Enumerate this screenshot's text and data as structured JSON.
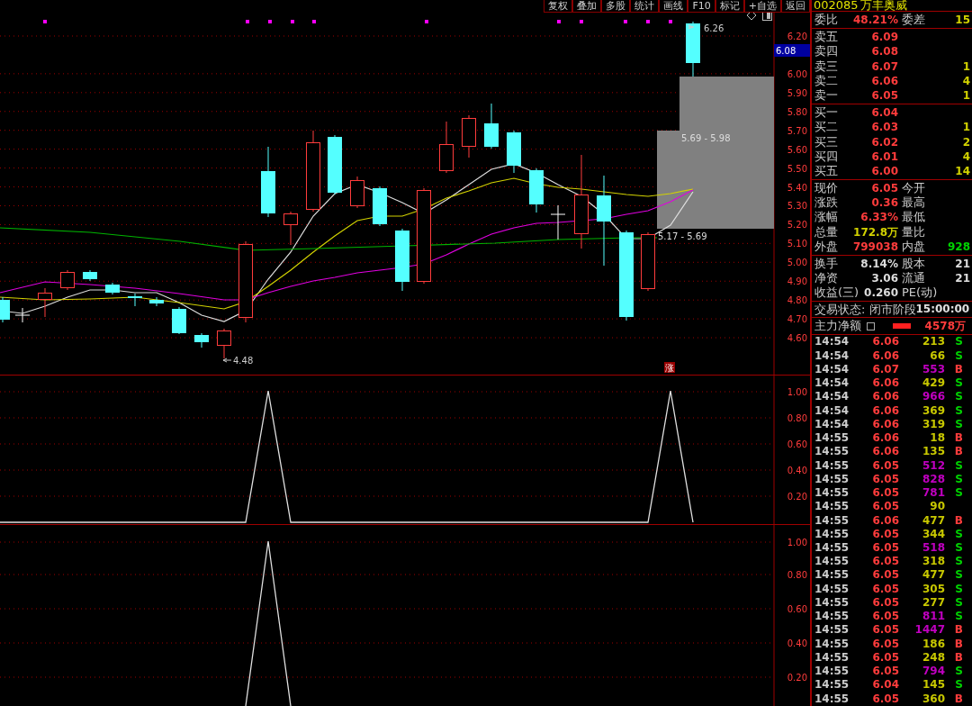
{
  "toolbar": {
    "buttons": [
      "复权",
      "叠加",
      "多股",
      "统计",
      "画线",
      "F10",
      "标记",
      "+自选",
      "返回"
    ]
  },
  "main_chart": {
    "price_ticks": [
      "6.20",
      "6.00",
      "5.90",
      "5.80",
      "5.70",
      "5.60",
      "5.50",
      "5.40",
      "5.30",
      "5.20",
      "5.10",
      "5.00",
      "4.90",
      "4.80",
      "4.70",
      "4.60"
    ],
    "current_price": "6.08",
    "high_label": "6.26",
    "low_label": "4.48",
    "zones": [
      {
        "label": "5.69 - 5.98"
      },
      {
        "label": "5.17 - 5.69"
      }
    ],
    "signal_label": "涨"
  },
  "indicator_1": {
    "ticks": [
      "1.00",
      "0.80",
      "0.60",
      "0.40",
      "0.20"
    ]
  },
  "indicator_2": {
    "ticks": [
      "1.00",
      "0.80",
      "0.60",
      "0.40",
      "0.20"
    ]
  },
  "quote": {
    "code": "002085",
    "name": "万丰奥威",
    "order_ratio": {
      "label": "委比",
      "value": "48.21%",
      "label2": "委差",
      "value2": "15"
    },
    "asks": [
      {
        "label": "卖五",
        "price": "6.09"
      },
      {
        "label": "卖四",
        "price": "6.08"
      },
      {
        "label": "卖三",
        "price": "6.07",
        "volume": "1"
      },
      {
        "label": "卖二",
        "price": "6.06",
        "volume": "4"
      },
      {
        "label": "卖一",
        "price": "6.05",
        "volume": "1"
      }
    ],
    "bids": [
      {
        "label": "买一",
        "price": "6.04"
      },
      {
        "label": "买二",
        "price": "6.03",
        "volume": "1"
      },
      {
        "label": "买三",
        "price": "6.02",
        "volume": "2"
      },
      {
        "label": "买四",
        "price": "6.01",
        "volume": "4"
      },
      {
        "label": "买五",
        "price": "6.00",
        "volume": "14"
      }
    ],
    "stats": [
      {
        "left": {
          "label": "现价",
          "value": "6.05",
          "color": "#ff3c3c"
        },
        "right": {
          "label": "今开"
        }
      },
      {
        "left": {
          "label": "涨跌",
          "value": "0.36",
          "color": "#ff3c3c"
        },
        "right": {
          "label": "最高"
        }
      },
      {
        "left": {
          "label": "涨幅",
          "value": "6.33%",
          "color": "#ff3c3c"
        },
        "right": {
          "label": "最低"
        }
      },
      {
        "left": {
          "label": "总量",
          "value": "172.8万",
          "color": "#d2d200"
        },
        "right": {
          "label": "量比"
        }
      },
      {
        "left": {
          "label": "外盘",
          "value": "799038",
          "color": "#ff3c3c"
        },
        "right": {
          "label": "内盘",
          "value": "928",
          "color": "#00d200"
        }
      }
    ],
    "shares": [
      {
        "left": {
          "label": "换手",
          "value": "8.14%"
        },
        "right": {
          "label": "股本",
          "value": "21"
        }
      },
      {
        "left": {
          "label": "净资",
          "value": "3.06"
        },
        "right": {
          "label": "流通",
          "value": "21"
        }
      },
      {
        "left": {
          "label": "收益(三)",
          "value": "0.260"
        },
        "right": {
          "label": "PE(动)"
        }
      }
    ],
    "trade_status": {
      "text": "交易状态: 闭市阶段",
      "time": "15:00:00"
    },
    "main_net": {
      "label": "主力净额",
      "value": "4578万"
    },
    "trades": [
      {
        "time": "14:54",
        "price": "6.06",
        "volume": "213",
        "color": "#c8c800",
        "side": "S",
        "kind": "sell"
      },
      {
        "time": "14:54",
        "price": "6.06",
        "volume": "66",
        "color": "#c8c800",
        "side": "S",
        "kind": "sell"
      },
      {
        "time": "14:54",
        "price": "6.07",
        "volume": "553",
        "color": "#c000c0",
        "side": "B",
        "kind": "buy"
      },
      {
        "time": "14:54",
        "price": "6.06",
        "volume": "429",
        "color": "#c8c800",
        "side": "S",
        "kind": "sell"
      },
      {
        "time": "14:54",
        "price": "6.06",
        "volume": "966",
        "color": "#c000c0",
        "side": "S",
        "kind": "sell"
      },
      {
        "time": "14:54",
        "price": "6.06",
        "volume": "369",
        "color": "#c8c800",
        "side": "S",
        "kind": "sell"
      },
      {
        "time": "14:54",
        "price": "6.06",
        "volume": "319",
        "color": "#c8c800",
        "side": "S",
        "kind": "sell"
      },
      {
        "time": "14:55",
        "price": "6.06",
        "volume": "18",
        "color": "#c8c800",
        "side": "B",
        "kind": "buy"
      },
      {
        "time": "14:55",
        "price": "6.06",
        "volume": "135",
        "color": "#c8c800",
        "side": "B",
        "kind": "buy"
      },
      {
        "time": "14:55",
        "price": "6.05",
        "volume": "512",
        "color": "#c000c0",
        "side": "S",
        "kind": "sell"
      },
      {
        "time": "14:55",
        "price": "6.05",
        "volume": "828",
        "color": "#c000c0",
        "side": "S",
        "kind": "sell"
      },
      {
        "time": "14:55",
        "price": "6.05",
        "volume": "781",
        "color": "#c000c0",
        "side": "S",
        "kind": "sell"
      },
      {
        "time": "14:55",
        "price": "6.05",
        "volume": "90",
        "color": "#c8c800"
      },
      {
        "time": "14:55",
        "price": "6.06",
        "volume": "477",
        "color": "#c8c800",
        "side": "B",
        "kind": "buy"
      },
      {
        "time": "14:55",
        "price": "6.05",
        "volume": "344",
        "color": "#c8c800",
        "side": "S",
        "kind": "sell"
      },
      {
        "time": "14:55",
        "price": "6.05",
        "volume": "518",
        "color": "#c000c0",
        "side": "S",
        "kind": "sell"
      },
      {
        "time": "14:55",
        "price": "6.05",
        "volume": "318",
        "color": "#c8c800",
        "side": "S",
        "kind": "sell"
      },
      {
        "time": "14:55",
        "price": "6.05",
        "volume": "477",
        "color": "#c8c800",
        "side": "S",
        "kind": "sell"
      },
      {
        "time": "14:55",
        "price": "6.05",
        "volume": "305",
        "color": "#c8c800",
        "side": "S",
        "kind": "sell"
      },
      {
        "time": "14:55",
        "price": "6.05",
        "volume": "277",
        "color": "#c8c800",
        "side": "S",
        "kind": "sell"
      },
      {
        "time": "14:55",
        "price": "6.05",
        "volume": "811",
        "color": "#c000c0",
        "side": "S",
        "kind": "sell"
      },
      {
        "time": "14:55",
        "price": "6.05",
        "volume": "1447",
        "color": "#c000c0",
        "side": "B",
        "kind": "buy"
      },
      {
        "time": "14:55",
        "price": "6.05",
        "volume": "186",
        "color": "#c8c800",
        "side": "B",
        "kind": "buy"
      },
      {
        "time": "14:55",
        "price": "6.05",
        "volume": "248",
        "color": "#c8c800",
        "side": "B",
        "kind": "buy"
      },
      {
        "time": "14:55",
        "price": "6.05",
        "volume": "794",
        "color": "#c000c0",
        "side": "S",
        "kind": "sell"
      },
      {
        "time": "14:55",
        "price": "6.04",
        "volume": "145",
        "color": "#c8c800",
        "side": "S",
        "kind": "sell"
      },
      {
        "time": "14:55",
        "price": "6.05",
        "volume": "360",
        "color": "#c8c800",
        "side": "B",
        "kind": "buy"
      }
    ]
  }
}
